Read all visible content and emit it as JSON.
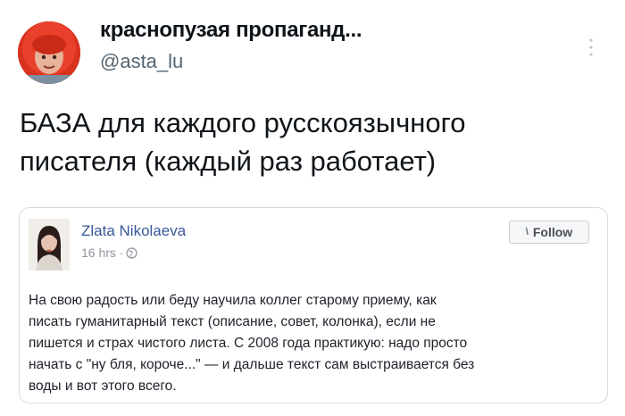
{
  "tweet": {
    "author_name": "краснопузая пропаганд...",
    "author_handle": "@asta_lu",
    "text_lines": [
      "БАЗА для каждого русскоязычного",
      "писателя (каждый раз работает)"
    ],
    "icons": {
      "avatar": "avatar-red-hood",
      "more": "more-vertical-icon"
    }
  },
  "quoted_post": {
    "author_name": "Zlata Nikolaeva",
    "time": "16 hrs ·",
    "follow_label": "Follow",
    "icons": {
      "follow": "rss-icon",
      "privacy": "globe-icon"
    },
    "text_lines": [
      "На свою радость или беду научила коллег старому приему, как",
      "писать гуманитарный текст (описание, совет, колонка), если не",
      "пишется и страх чистого листа. С 2008 года практикую: надо просто",
      "начать с \"ну бля, короче...\" — и дальше текст сам выстраивается без",
      "воды и вот этого всего."
    ]
  },
  "colors": {
    "fb_link": "#385898",
    "handle_gray": "#536471",
    "avatar_red": "#e23b2a"
  }
}
